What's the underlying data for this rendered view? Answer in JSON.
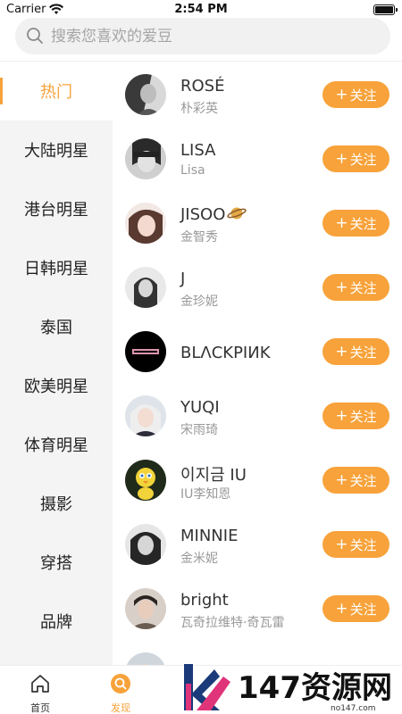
{
  "status_bar": {
    "carrier": "Carrier",
    "time": "2:54 PM"
  },
  "search": {
    "placeholder": "搜索您喜欢的爱豆"
  },
  "sidebar": {
    "items": [
      {
        "label": "热门",
        "active": true
      },
      {
        "label": "大陆明星"
      },
      {
        "label": "港台明星"
      },
      {
        "label": "日韩明星"
      },
      {
        "label": "泰国"
      },
      {
        "label": "欧美明星"
      },
      {
        "label": "体育明星"
      },
      {
        "label": "摄影"
      },
      {
        "label": "穿搭"
      },
      {
        "label": "品牌"
      }
    ]
  },
  "follow_label": "关注",
  "idols": [
    {
      "name": "ROSÉ",
      "sub": "朴彩英"
    },
    {
      "name": "LISA",
      "sub": "Lisa"
    },
    {
      "name": "JISOO",
      "sub": "金智秀",
      "emoji": "ringed-planet-icon"
    },
    {
      "name": "J",
      "sub": "金珍妮"
    },
    {
      "name": "BLΛCKPIИK",
      "sub": ""
    },
    {
      "name": "YUQI",
      "sub": "宋雨琦"
    },
    {
      "name": "이지금 IU",
      "sub": "IU李知恩"
    },
    {
      "name": "MINNIE",
      "sub": "金米妮"
    },
    {
      "name": "bright",
      "sub": "瓦奇拉维特·奇瓦雷"
    }
  ],
  "tabbar": {
    "tabs": [
      {
        "label": "首页",
        "icon": "home-icon"
      },
      {
        "label": "发现",
        "icon": "discover-icon",
        "active": true
      }
    ]
  },
  "watermark": {
    "text": "147资源网",
    "url": "no147.com"
  },
  "colors": {
    "accent": "#f7a23a",
    "sidebar_bg": "#f4f4f4",
    "search_bg": "#f1f1f1"
  }
}
